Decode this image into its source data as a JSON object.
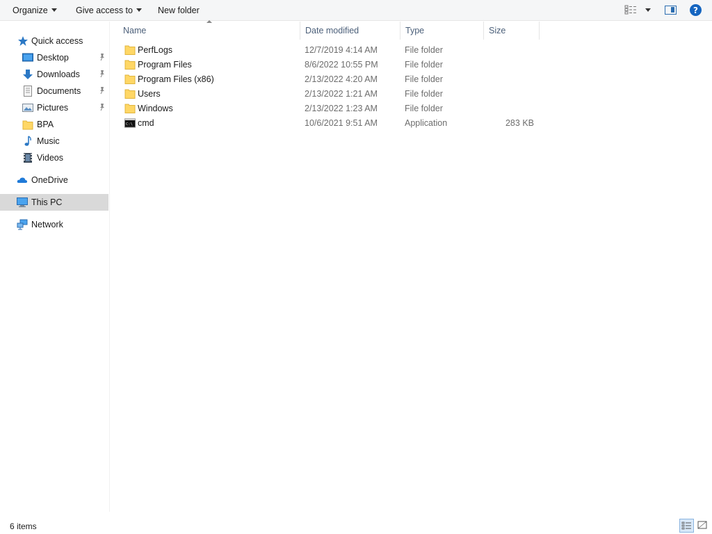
{
  "toolbar": {
    "organize_label": "Organize",
    "give_access_label": "Give access to",
    "new_folder_label": "New folder",
    "help_label": "?"
  },
  "nav": {
    "quick_access": "Quick access",
    "items": [
      {
        "label": "Desktop",
        "icon": "desktop-icon",
        "pinned": true
      },
      {
        "label": "Downloads",
        "icon": "downloads-icon",
        "pinned": true
      },
      {
        "label": "Documents",
        "icon": "documents-icon",
        "pinned": true
      },
      {
        "label": "Pictures",
        "icon": "pictures-icon",
        "pinned": true
      },
      {
        "label": "BPA",
        "icon": "folder-icon",
        "pinned": false
      },
      {
        "label": "Music",
        "icon": "music-icon",
        "pinned": false
      },
      {
        "label": "Videos",
        "icon": "videos-icon",
        "pinned": false
      }
    ],
    "onedrive": "OneDrive",
    "this_pc": "This PC",
    "network": "Network"
  },
  "columns": {
    "name": "Name",
    "date_modified": "Date modified",
    "type": "Type",
    "size": "Size"
  },
  "files": [
    {
      "name": "PerfLogs",
      "date": "12/7/2019 4:14 AM",
      "type": "File folder",
      "size": "",
      "icon": "folder-icon"
    },
    {
      "name": "Program Files",
      "date": "8/6/2022 10:55 PM",
      "type": "File folder",
      "size": "",
      "icon": "folder-icon"
    },
    {
      "name": "Program Files (x86)",
      "date": "2/13/2022 4:20 AM",
      "type": "File folder",
      "size": "",
      "icon": "folder-icon"
    },
    {
      "name": "Users",
      "date": "2/13/2022 1:21 AM",
      "type": "File folder",
      "size": "",
      "icon": "folder-icon"
    },
    {
      "name": "Windows",
      "date": "2/13/2022 1:23 AM",
      "type": "File folder",
      "size": "",
      "icon": "folder-icon"
    },
    {
      "name": "cmd",
      "date": "10/6/2021 9:51 AM",
      "type": "Application",
      "size": "283 KB",
      "icon": "cmd-icon"
    }
  ],
  "status": {
    "item_count": "6 items"
  },
  "colors": {
    "selection": "#d9d9d9",
    "header_text": "#4c607a",
    "folder_yellow": "#ffd766",
    "accent_blue": "#1565c0"
  }
}
